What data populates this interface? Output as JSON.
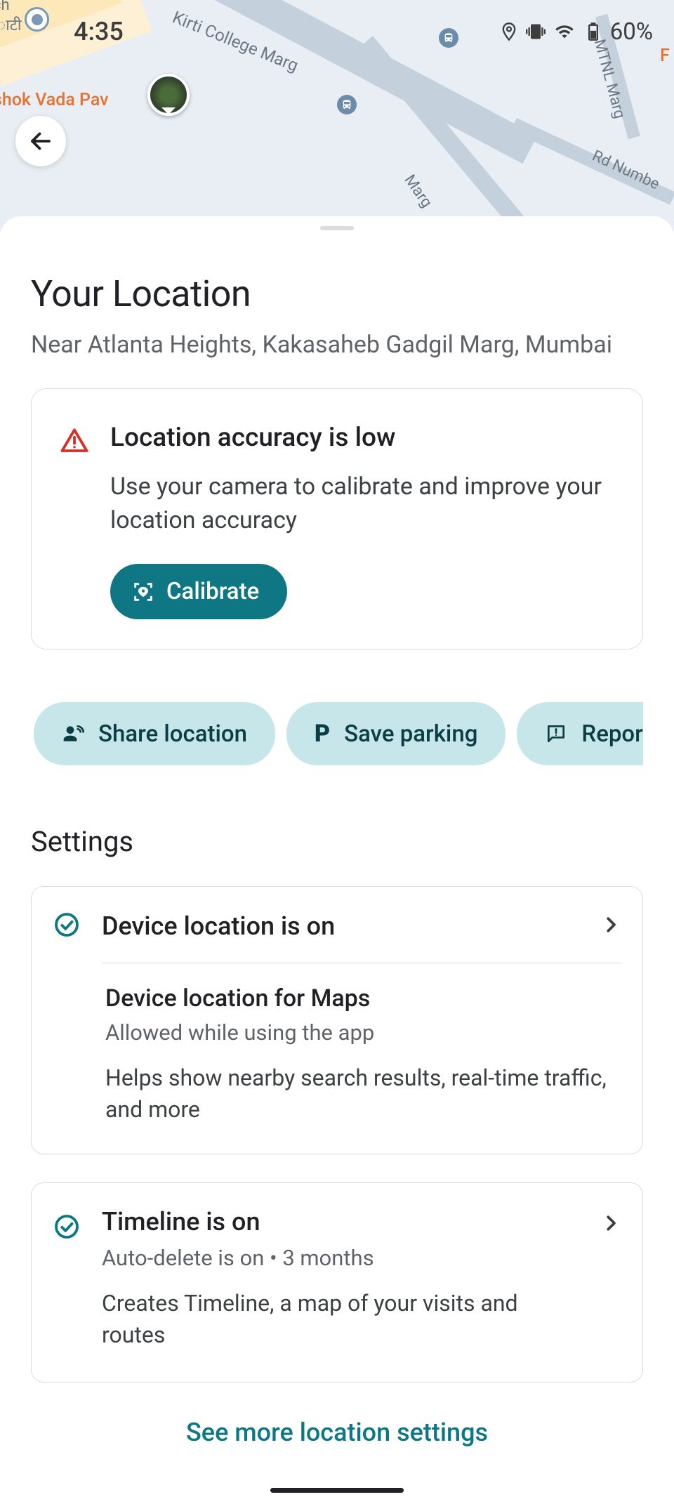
{
  "status": {
    "time": "4:35",
    "battery_pct": "60%"
  },
  "map": {
    "street1": "Kirti College Marg",
    "street2": "Marg",
    "street3": "Rd Numbe",
    "street4": "MTNL Marg",
    "poi1": "shok Vada Pav",
    "poi2": "F",
    "hindi": "ाटी",
    "ch": "ch"
  },
  "sheet": {
    "title": "Your Location",
    "subtitle": "Near Atlanta Heights, Kakasaheb Gadgil Marg, Mumbai"
  },
  "accuracy": {
    "title": "Location accuracy is low",
    "desc": "Use your camera to calibrate and improve your location accuracy",
    "button": "Calibrate"
  },
  "chips": {
    "share": "Share location",
    "parking": "Save parking",
    "report": "Report"
  },
  "settings": {
    "heading": "Settings",
    "device_location": {
      "title": "Device location is on",
      "sub_title": "Device location for Maps",
      "sub_status": "Allowed while using the app",
      "sub_desc": "Helps show nearby search results, real-time traffic, and more"
    },
    "timeline": {
      "title": "Timeline is on",
      "sub_status": "Auto-delete is on • 3 months",
      "sub_desc": "Creates Timeline, a map of your visits and routes"
    },
    "see_more": "See more location settings"
  }
}
